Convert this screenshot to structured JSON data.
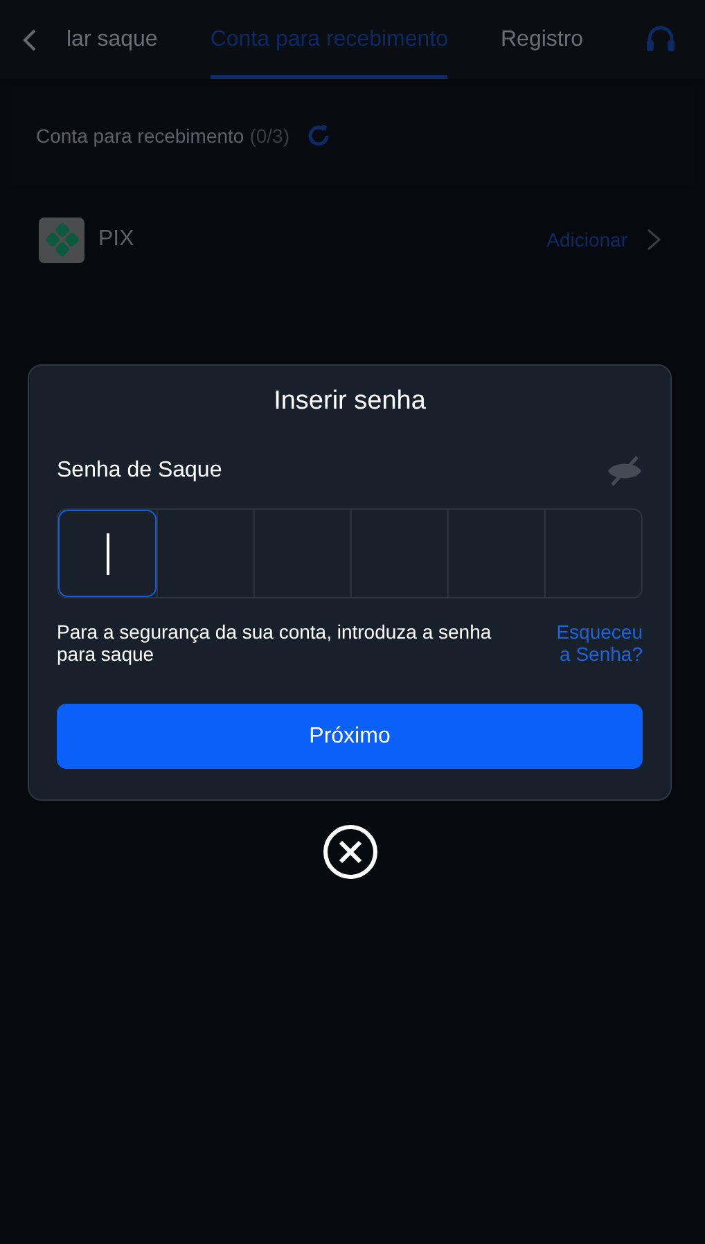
{
  "tabs": [
    {
      "label": "lar saque",
      "selected": false
    },
    {
      "label": "Conta para recebimento",
      "selected": true
    },
    {
      "label": "Registro",
      "selected": false
    }
  ],
  "accounts_section": {
    "title": "Conta para recebimento",
    "count": "(0/3)"
  },
  "accounts": [
    {
      "name": "PIX",
      "action": "Adicionar"
    }
  ],
  "dialog": {
    "title": "Inserir senha",
    "field_label": "Senha de Saque",
    "password_visible": false,
    "cells": [
      {
        "focused": true
      },
      {
        "focused": false
      },
      {
        "focused": false
      },
      {
        "focused": false
      },
      {
        "focused": false
      },
      {
        "focused": false
      }
    ],
    "hint": "Para a segurança da sua conta, introduza a senha para saque",
    "forgot_link": "Esqueceu a Senha?",
    "button": "Próximo"
  }
}
